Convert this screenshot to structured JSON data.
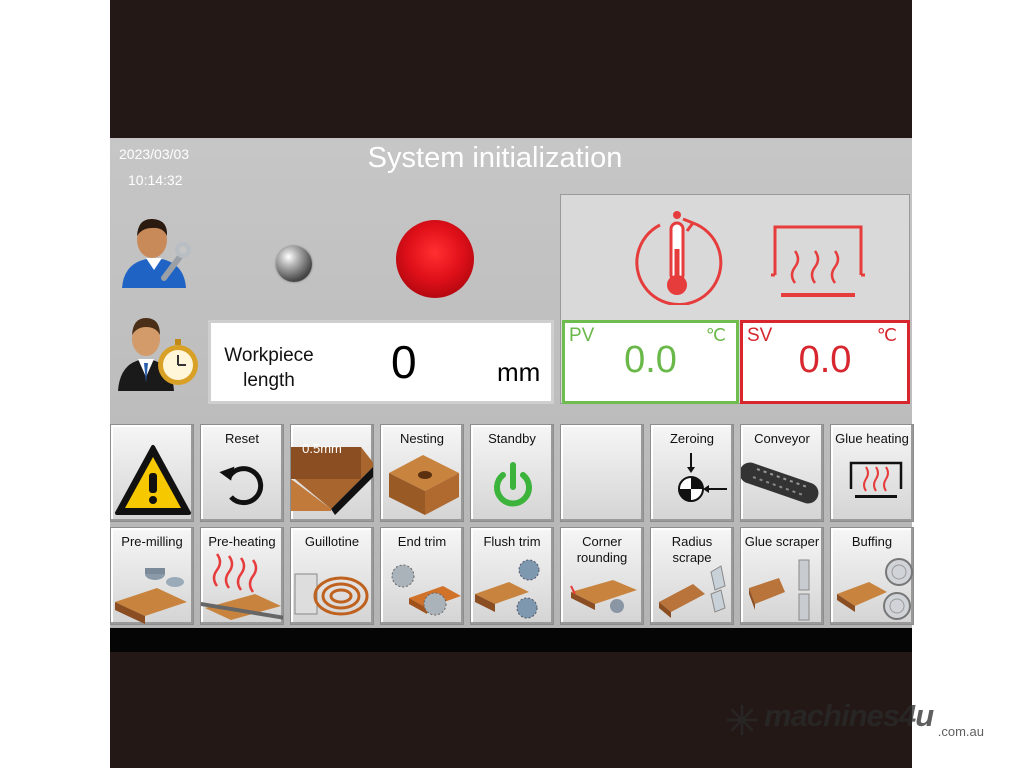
{
  "header": {
    "date": "2023/03/03",
    "time": "10:14:32",
    "title": "System initialization"
  },
  "workpiece": {
    "label": "Workpiece length",
    "value": "0",
    "unit": "mm"
  },
  "temperature": {
    "pv": {
      "label": "PV",
      "value": "0.0",
      "unit": "℃",
      "color": "#6ab84a"
    },
    "sv": {
      "label": "SV",
      "value": "0.0",
      "unit": "℃",
      "color": "#d7262e"
    }
  },
  "indicators": {
    "status_color": "#e0101a"
  },
  "row1": [
    {
      "label": "",
      "icon": "warning-icon"
    },
    {
      "label": "Reset",
      "icon": "reset-icon"
    },
    {
      "label": "0.5mm",
      "icon": "edge-thickness-icon"
    },
    {
      "label": "Nesting",
      "icon": "nesting-icon"
    },
    {
      "label": "Standby",
      "icon": "power-icon"
    },
    {
      "label": "",
      "icon": ""
    },
    {
      "label": "Zeroing",
      "icon": "zeroing-icon"
    },
    {
      "label": "Conveyor",
      "icon": "conveyor-icon"
    },
    {
      "label": "Glue heating",
      "icon": "glue-heating-icon"
    }
  ],
  "row2": [
    {
      "label": "Pre-milling",
      "icon": "pre-milling-icon"
    },
    {
      "label": "Pre-heating",
      "icon": "pre-heating-icon"
    },
    {
      "label": "Guillotine",
      "icon": "guillotine-icon"
    },
    {
      "label": "End trim",
      "icon": "end-trim-icon"
    },
    {
      "label": "Flush trim",
      "icon": "flush-trim-icon"
    },
    {
      "label": "Corner rounding",
      "icon": "corner-rounding-icon"
    },
    {
      "label": "Radius scrape",
      "icon": "radius-scrape-icon"
    },
    {
      "label": "Glue scraper",
      "icon": "glue-scraper-icon"
    },
    {
      "label": "Buffing",
      "icon": "buffing-icon"
    }
  ],
  "watermark": {
    "name": "machines4u",
    "domain": ".com.au"
  }
}
